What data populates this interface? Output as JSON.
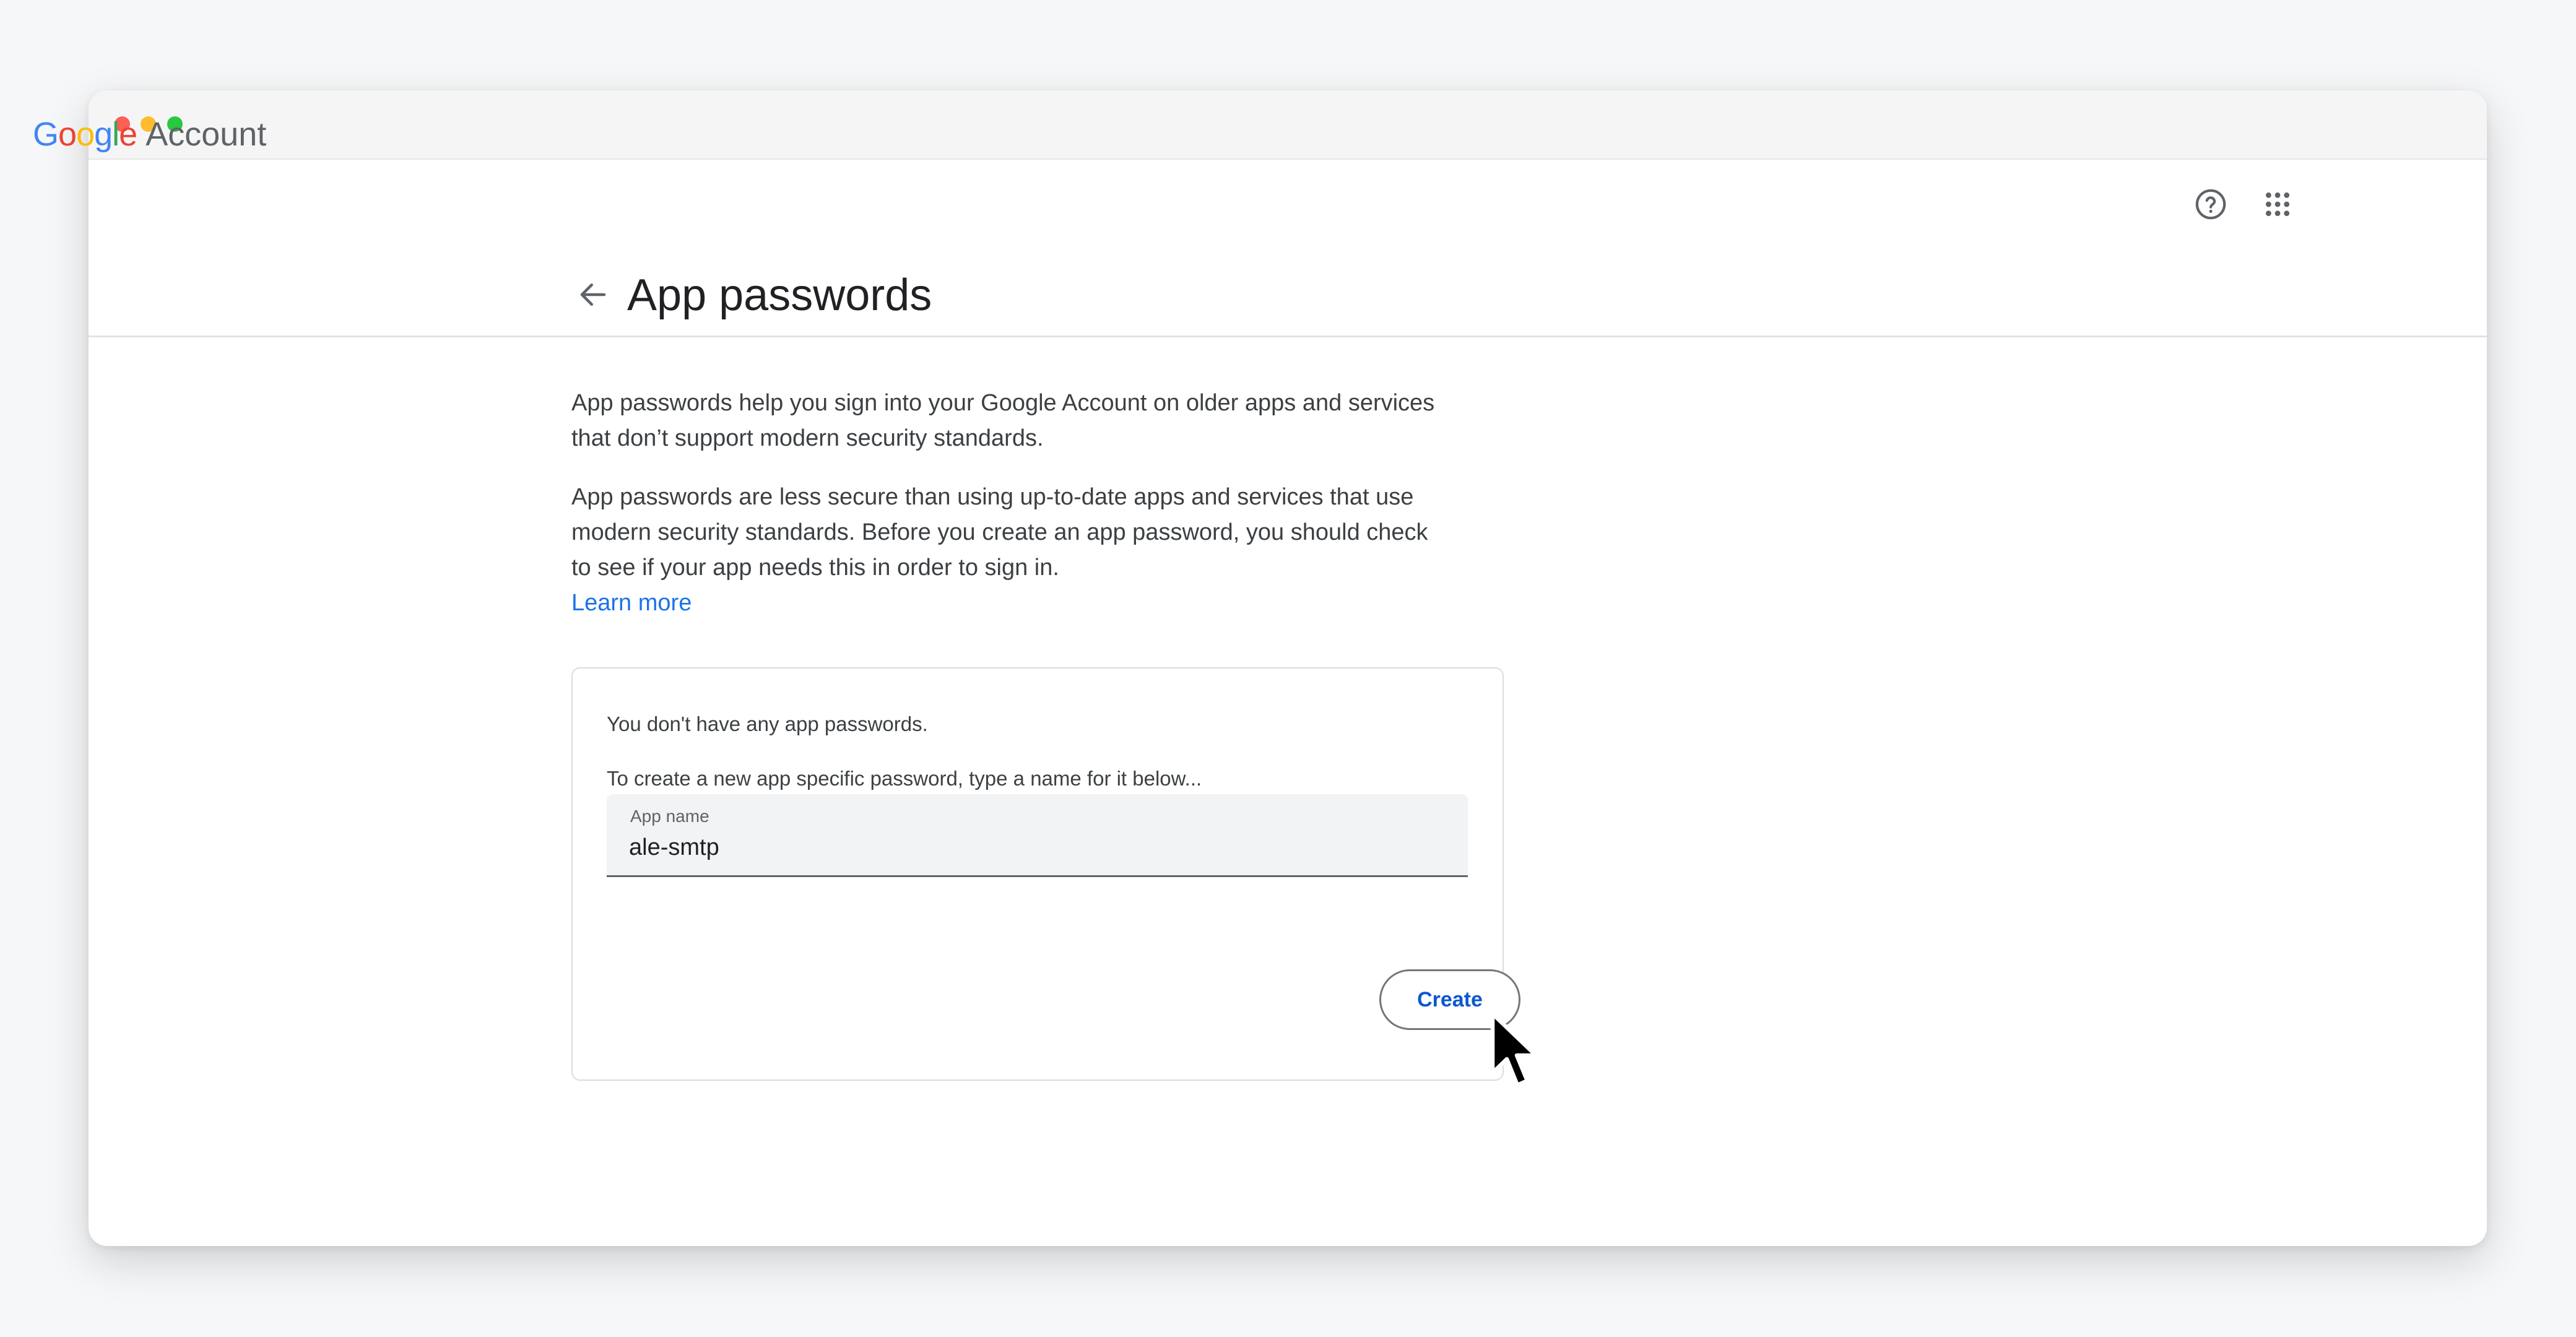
{
  "header": {
    "logo_google": [
      "G",
      "o",
      "o",
      "g",
      "l",
      "e"
    ],
    "logo_account": "Account",
    "help_icon": "help-circle-icon",
    "apps_icon": "apps-grid-icon"
  },
  "page": {
    "back_icon": "arrow-left-icon",
    "title": "App passwords",
    "description_1": "App passwords help you sign into your Google Account on older apps and services that don’t support modern security standards.",
    "description_2": "App passwords are less secure than using up-to-date apps and services that use modern security standards. Before you create an app password, you should check to see if your app needs this in order to sign in.",
    "learn_more": "Learn more"
  },
  "card": {
    "empty_note": "You don't have any app passwords.",
    "instruction": "To create a new app specific password, type a name for it below...",
    "field_label": "App name",
    "field_value": "ale-smtp",
    "create_label": "Create"
  },
  "colors": {
    "accent": "#1a73e8",
    "button_text": "#0b57d0",
    "text_primary": "#202124",
    "text_secondary": "#3c4043"
  }
}
